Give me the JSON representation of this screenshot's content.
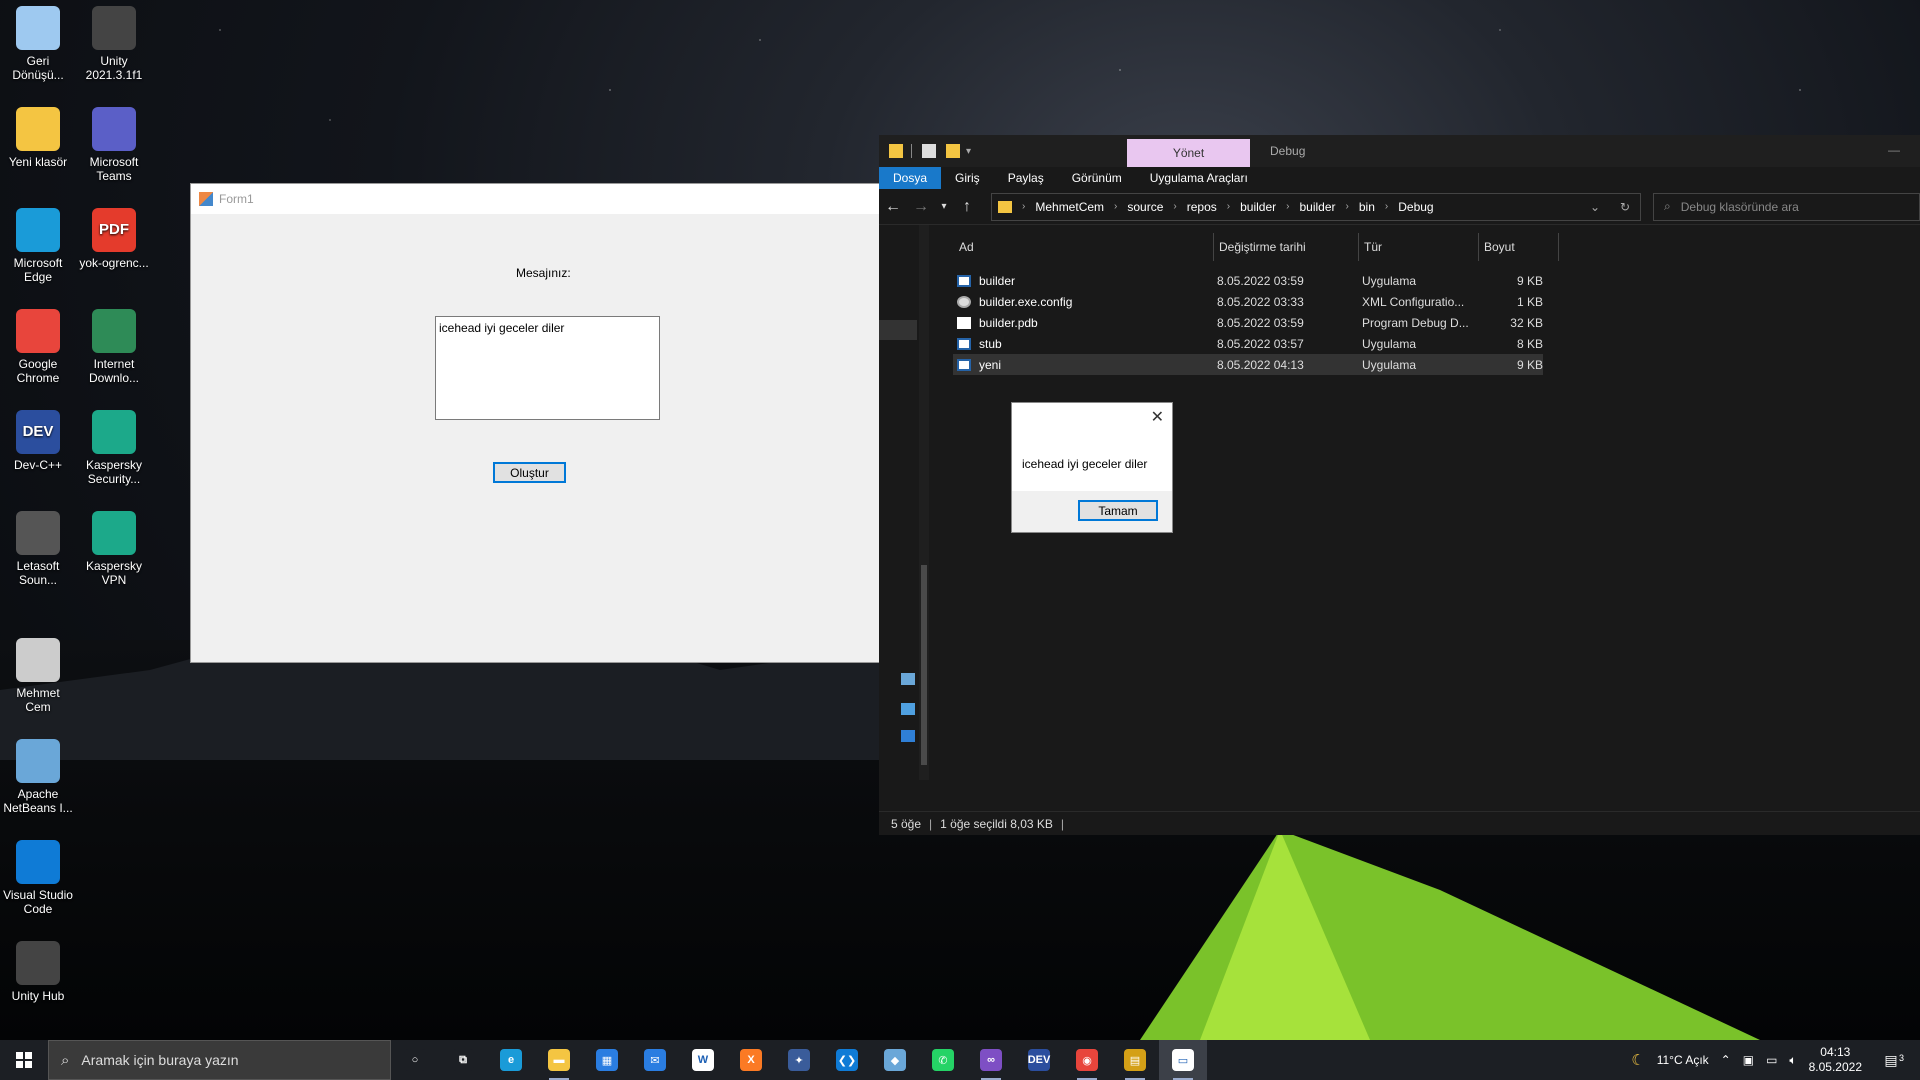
{
  "desktop": {
    "icons": [
      {
        "label": "Geri\nDönüşü...",
        "icon": "recycle-bin-icon",
        "color": "#9ec9f0"
      },
      {
        "label": "Unity\n2021.3.1f1",
        "icon": "unity-icon",
        "color": "#444444"
      },
      {
        "label": "Yeni klasör",
        "icon": "folder-icon",
        "color": "#f4c542"
      },
      {
        "label": "Microsoft\nTeams",
        "icon": "teams-icon",
        "color": "#5b5fc7"
      },
      {
        "label": "Microsoft\nEdge",
        "icon": "edge-icon",
        "color": "#1a9bd8"
      },
      {
        "label": "yok-ogrenc...",
        "icon": "pdf-icon",
        "color": "#e43b2c"
      },
      {
        "label": "Google\nChrome",
        "icon": "chrome-icon",
        "color": "#e8453c"
      },
      {
        "label": "Internet\nDownlo...",
        "icon": "idm-icon",
        "color": "#2e8b57"
      },
      {
        "label": "Dev-C++",
        "icon": "devcpp-icon",
        "color": "#2b4e9e"
      },
      {
        "label": "Kaspersky\nSecurity...",
        "icon": "kaspersky-security-icon",
        "color": "#1ca98a"
      },
      {
        "label": "Letasoft\nSoun...",
        "icon": "speaker-icon",
        "color": "#555555"
      },
      {
        "label": "Kaspersky\nVPN",
        "icon": "kaspersky-vpn-icon",
        "color": "#1ca98a"
      },
      {
        "label": "Mehmet\nCem",
        "icon": "drive-icon",
        "color": "#cccccc"
      },
      {
        "label": "Apache\nNetBeans I...",
        "icon": "netbeans-icon",
        "color": "#6aa7d8"
      },
      {
        "label": "Visual Studio\nCode",
        "icon": "vscode-icon",
        "color": "#0f7bd6"
      },
      {
        "label": "Unity Hub",
        "icon": "unity-hub-icon",
        "color": "#444444"
      }
    ],
    "badges": {
      "pdf": "PDF",
      "dev": "DEV"
    }
  },
  "form1": {
    "title": "Form1",
    "label": "Mesajınız:",
    "textbox_value": "icehead iyi geceler diler",
    "button": "Oluştur"
  },
  "explorer": {
    "context_tab": "Yönet",
    "context_title": "Debug",
    "minimize": "—",
    "ribbon_tabs": [
      "Dosya",
      "Giriş",
      "Paylaş",
      "Görünüm",
      "Uygulama Araçları"
    ],
    "breadcrumb": [
      "MehmetCem",
      "source",
      "repos",
      "builder",
      "builder",
      "bin",
      "Debug"
    ],
    "search_placeholder": "Debug klasöründe ara",
    "columns": [
      "Ad",
      "Değiştirme tarihi",
      "Tür",
      "Boyut"
    ],
    "files": [
      {
        "name": "builder",
        "date": "8.05.2022 03:59",
        "type": "Uygulama",
        "size": "9 KB",
        "kind": "exe"
      },
      {
        "name": "builder.exe.config",
        "date": "8.05.2022 03:33",
        "type": "XML Configuratio...",
        "size": "1 KB",
        "kind": "cfg"
      },
      {
        "name": "builder.pdb",
        "date": "8.05.2022 03:59",
        "type": "Program Debug D...",
        "size": "32 KB",
        "kind": "pdb"
      },
      {
        "name": "stub",
        "date": "8.05.2022 03:57",
        "type": "Uygulama",
        "size": "8 KB",
        "kind": "exe"
      },
      {
        "name": "yeni",
        "date": "8.05.2022 04:13",
        "type": "Uygulama",
        "size": "9 KB",
        "kind": "exe",
        "selected": true
      }
    ],
    "status": {
      "count": "5 öğe",
      "selected": "1 öğe seçildi  8,03 KB"
    }
  },
  "messagebox": {
    "text": "icehead iyi geceler diler",
    "ok": "Tamam"
  },
  "taskbar": {
    "search_placeholder": "Aramak için buraya yazın",
    "apps": [
      {
        "name": "cortana",
        "icon": "cortana-icon",
        "color": "#1c1f24",
        "glyph": "○"
      },
      {
        "name": "task-view",
        "icon": "task-view-icon",
        "color": "#1c1f24",
        "glyph": "⧉"
      },
      {
        "name": "edge",
        "icon": "edge-icon",
        "color": "#1a9bd8",
        "glyph": "e"
      },
      {
        "name": "file-explorer",
        "icon": "folder-icon",
        "color": "#f4c542",
        "glyph": "▬",
        "running": true
      },
      {
        "name": "store",
        "icon": "store-icon",
        "color": "#2a7de1",
        "glyph": "▦"
      },
      {
        "name": "mail",
        "icon": "mail-icon",
        "color": "#2a7de1",
        "glyph": "✉"
      },
      {
        "name": "winword-app",
        "icon": "w-icon",
        "color": "#ffffff",
        "glyph": "W"
      },
      {
        "name": "xampp",
        "icon": "xampp-icon",
        "color": "#fb7a24",
        "glyph": "X"
      },
      {
        "name": "dbeaver",
        "icon": "db-icon",
        "color": "#3a5c9a",
        "glyph": "✦"
      },
      {
        "name": "vscode",
        "icon": "vscode-icon",
        "color": "#0f7bd6",
        "glyph": "❮❯"
      },
      {
        "name": "netbeans",
        "icon": "netbeans-icon",
        "color": "#6aa7d8",
        "glyph": "◆"
      },
      {
        "name": "whatsapp",
        "icon": "whatsapp-icon",
        "color": "#25d366",
        "glyph": "✆"
      },
      {
        "name": "visual-studio",
        "icon": "visual-studio-icon",
        "color": "#7e4fc4",
        "glyph": "∞",
        "running": true
      },
      {
        "name": "devcpp",
        "icon": "devcpp-icon",
        "color": "#2b4e9e",
        "glyph": "DEV"
      },
      {
        "name": "chrome",
        "icon": "chrome-icon",
        "color": "#e8453c",
        "glyph": "◉",
        "running": true
      },
      {
        "name": "winforms-app",
        "icon": "form-app-icon",
        "color": "#d4a017",
        "glyph": "▤",
        "running": true
      },
      {
        "name": "explorer-window",
        "icon": "window-icon",
        "color": "#ffffff",
        "glyph": "▭",
        "active": true
      }
    ],
    "weather": "11°C  Açık",
    "time": "04:13",
    "date": "8.05.2022",
    "notification_count": "3"
  }
}
